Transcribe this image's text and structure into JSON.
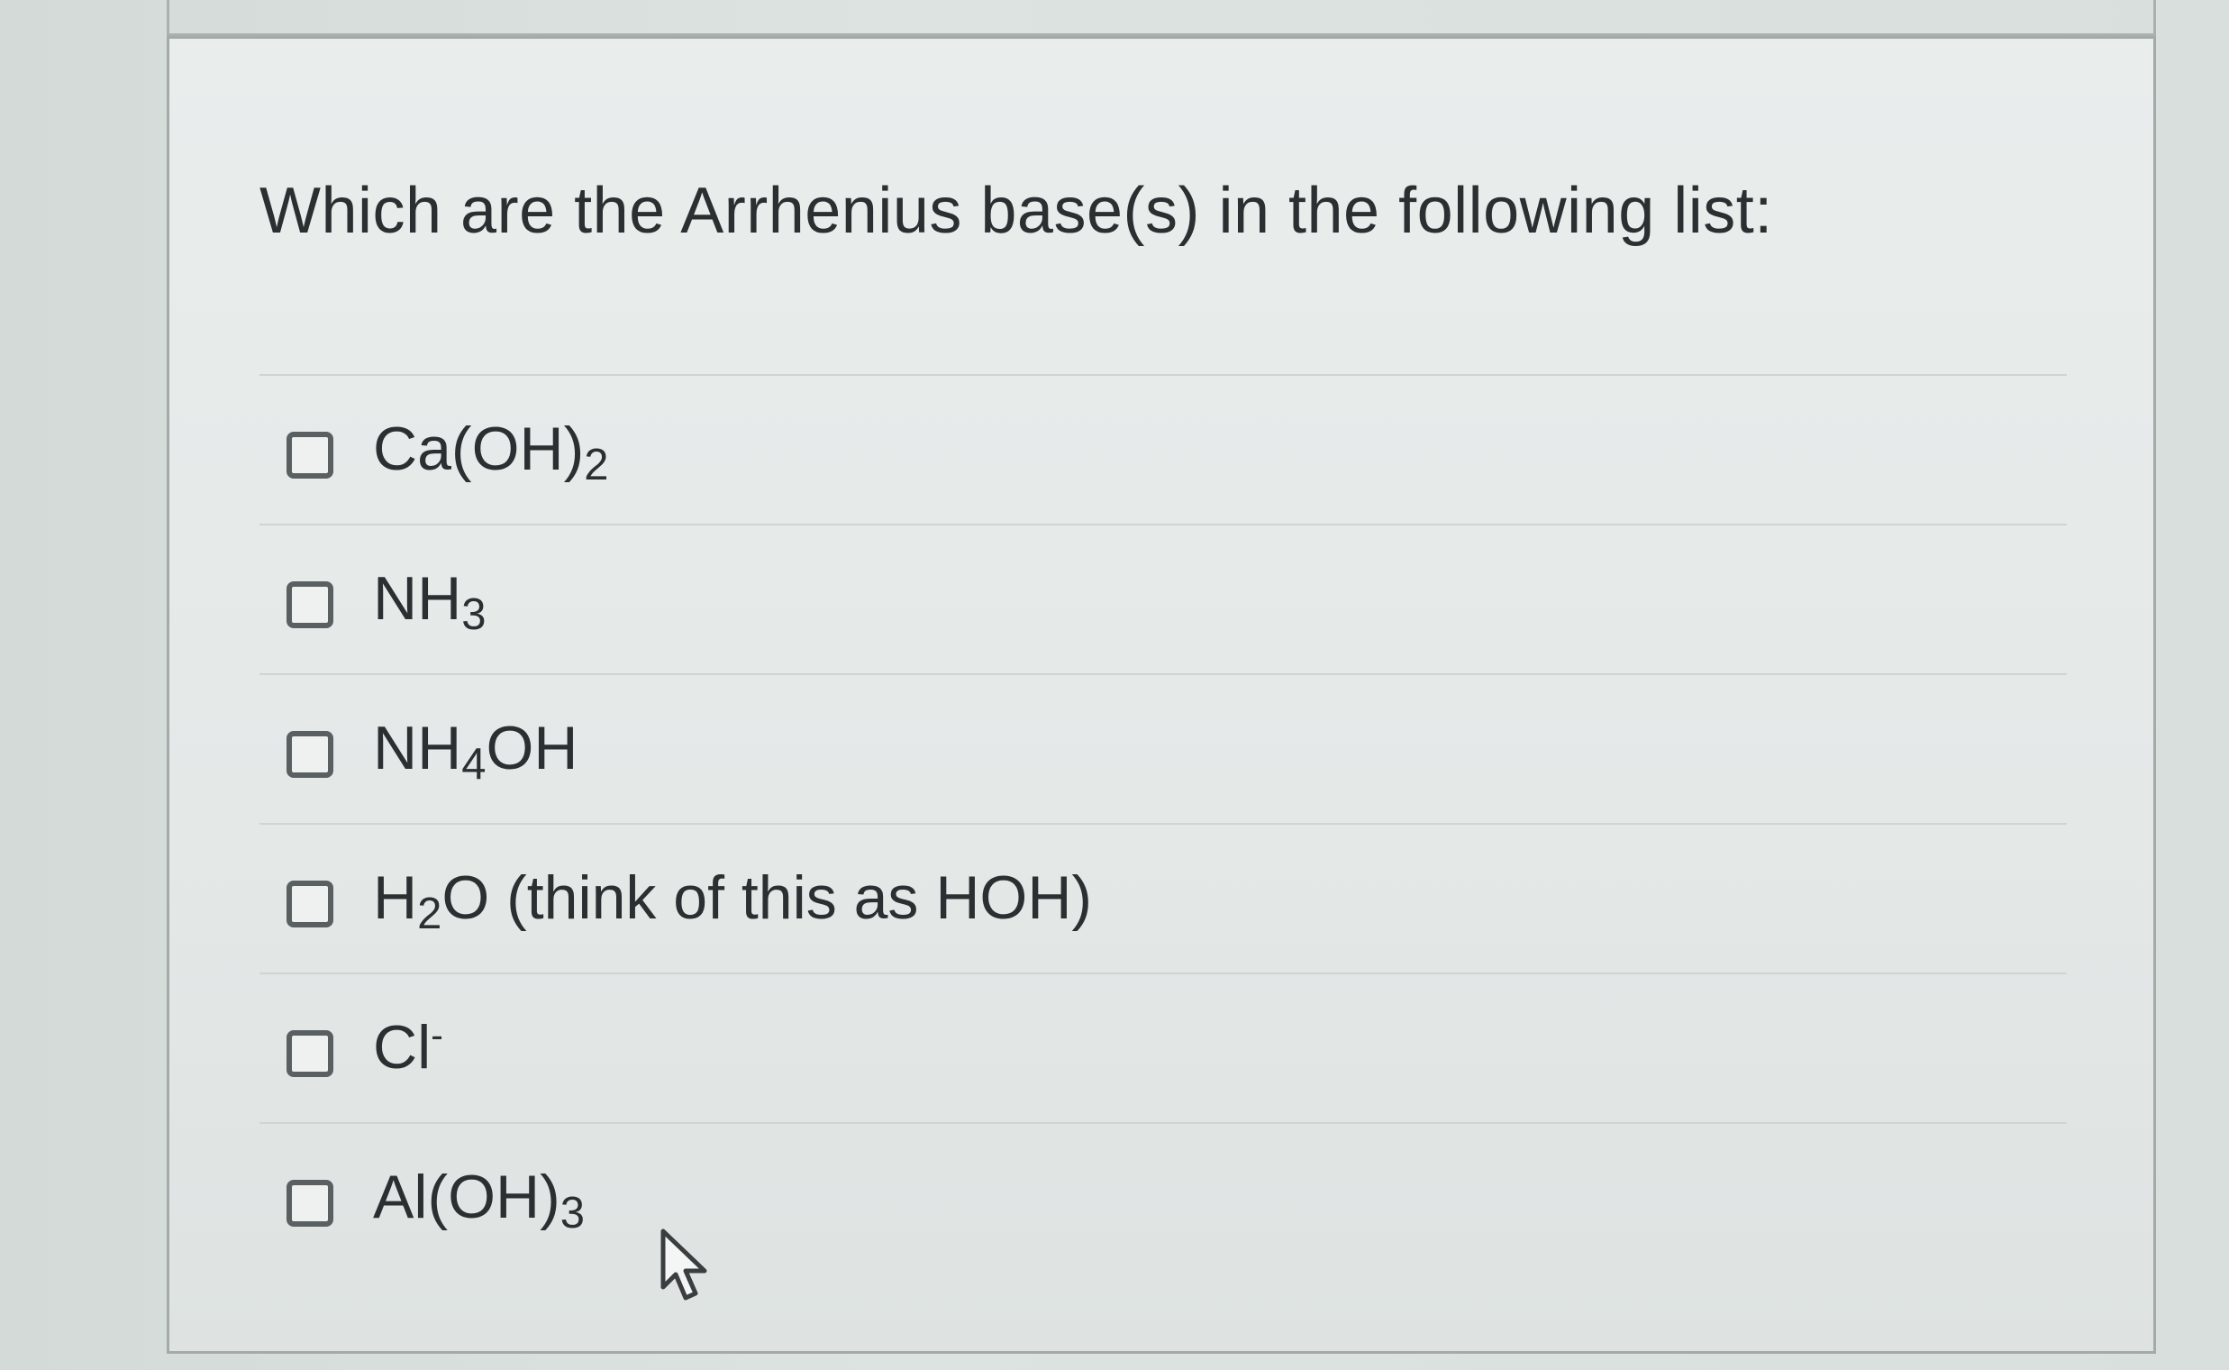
{
  "question": {
    "text": "Which are the Arrhenius base(s) in the following list:"
  },
  "options": [
    {
      "parts": [
        {
          "t": "Ca(OH)"
        },
        {
          "sub": "2"
        }
      ],
      "checked": false
    },
    {
      "parts": [
        {
          "t": "NH"
        },
        {
          "sub": "3"
        }
      ],
      "checked": false
    },
    {
      "parts": [
        {
          "t": "NH"
        },
        {
          "sub": "4"
        },
        {
          "t": "OH"
        }
      ],
      "checked": false
    },
    {
      "parts": [
        {
          "t": "H"
        },
        {
          "sub": "2"
        },
        {
          "t": "O (think of this as HOH)"
        }
      ],
      "checked": false
    },
    {
      "parts": [
        {
          "t": "Cl"
        },
        {
          "sup": "-"
        }
      ],
      "checked": false
    },
    {
      "parts": [
        {
          "t": "Al(OH)"
        },
        {
          "sub": "3"
        }
      ],
      "checked": false
    }
  ],
  "icons": {
    "cursor": "mouse-pointer-icon"
  },
  "colors": {
    "text": "#2c2f31",
    "checkbox_border": "#5a5f62",
    "panel_border": "#a3aaa7"
  }
}
